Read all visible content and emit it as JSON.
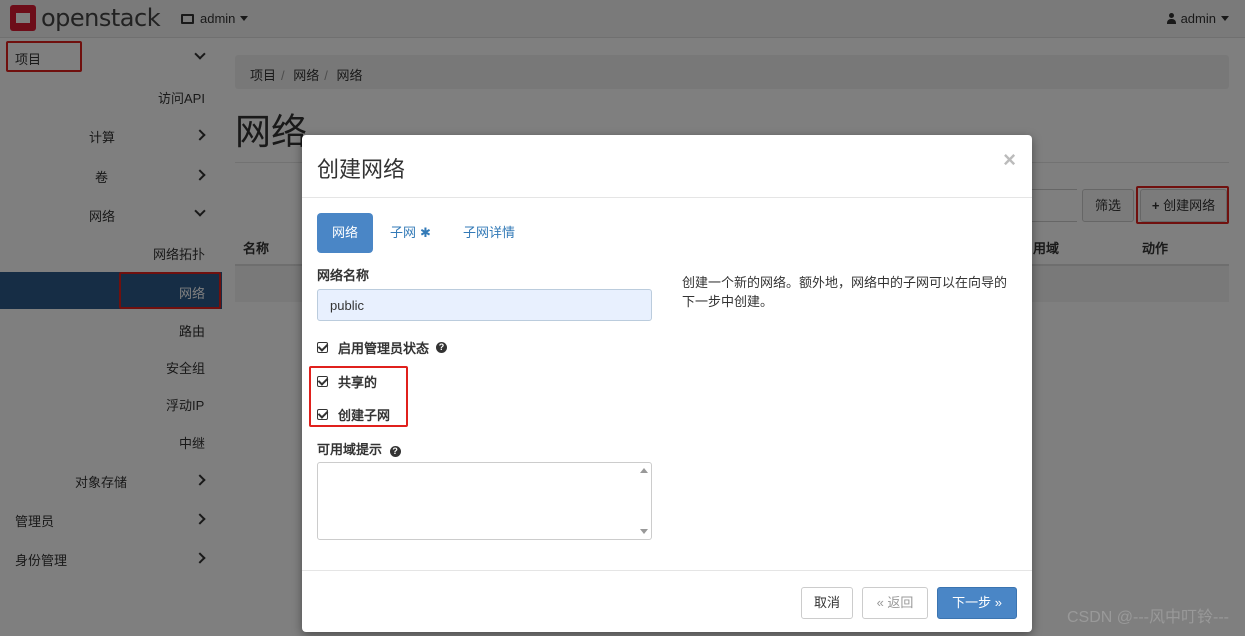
{
  "navbar": {
    "logo_text": "openstack",
    "project_label": "admin",
    "user_label": "admin"
  },
  "sidebar": {
    "project": "项目",
    "access_api": "访问API",
    "compute": "计算",
    "volume": "卷",
    "network": "网络",
    "network_topology": "网络拓扑",
    "networks": "网络",
    "routers": "路由",
    "security_groups": "安全组",
    "floating_ip": "浮动IP",
    "trunks": "中继",
    "object_store": "对象存储",
    "admin": "管理员",
    "identity": "身份管理"
  },
  "breadcrumb": [
    "项目",
    "网络",
    "网络"
  ],
  "page_title": "网络",
  "toolbar": {
    "filter_label": "筛选",
    "create_label": "创建网络"
  },
  "table": {
    "headers": [
      "名称",
      "用域",
      "动作"
    ]
  },
  "modal": {
    "title": "创建网络",
    "close": "×",
    "tabs": [
      "网络",
      "子网",
      "子网详情"
    ],
    "subnet_required_mark": "✱",
    "network_name_label": "网络名称",
    "network_name_value": "public",
    "admin_state_label": "启用管理员状态",
    "shared_label": "共享的",
    "create_subnet_label": "创建子网",
    "az_hint_label": "可用域提示",
    "help_text": "创建一个新的网络。额外地，网络中的子网可以在向导的下一步中创建。",
    "cancel": "取消",
    "back": "« 返回",
    "next": "下一步 »"
  },
  "watermark": "CSDN @---风中叮铃---"
}
